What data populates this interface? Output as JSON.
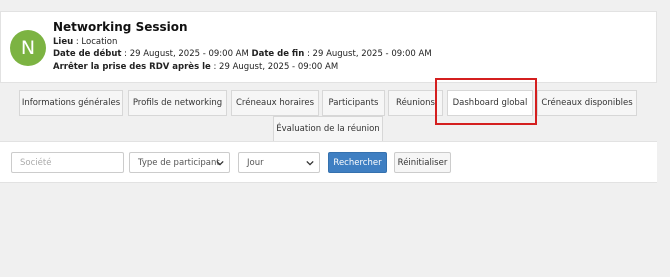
{
  "session": {
    "avatar_letter": "N",
    "avatar_color": "#7cb342",
    "title": "Networking Session",
    "lieu_label": "Lieu",
    "lieu_value": " : Location",
    "date_debut_label": "Date de début",
    "date_debut_value": " : 29 August, 2025 - 09:00 AM ",
    "date_fin_label": "Date de fin",
    "date_fin_value": " : 29 August, 2025 - 09:00 AM",
    "arret_label": "Arrêter la prise des RDV après le",
    "arret_value": " : 29 August, 2025 - 09:00 AM"
  },
  "tabs": [
    {
      "label": "Informations générales"
    },
    {
      "label": "Profils de networking"
    },
    {
      "label": "Créneaux horaires"
    },
    {
      "label": "Participants"
    },
    {
      "label": "Réunions"
    },
    {
      "label": "Dashboard global"
    },
    {
      "label": "Créneaux disponibles"
    },
    {
      "label": "Évaluation de la réunion"
    }
  ],
  "filters": {
    "societe_placeholder": "Société",
    "type_participant": "Type de participant",
    "jour": "Jour",
    "search_label": "Rechercher",
    "reset_label": "Réinitialiser"
  },
  "colors": {
    "highlight": "#d41f1f",
    "primary_button": "#3f7fc2"
  }
}
